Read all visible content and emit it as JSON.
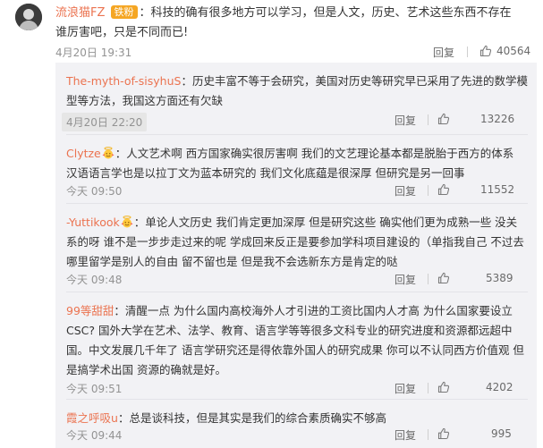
{
  "top_comment": {
    "username": "流浪猫FZ",
    "badge": "铁粉",
    "separator": "：",
    "text": "科技的确有很多地方可以学习，但是人文，历史、艺术这些东西不存在谁厉害吧，只是不同而已!",
    "time": "4月20日 19:31",
    "reply_label": "回复",
    "likes": "40564"
  },
  "replies": [
    {
      "username": "The-myth-of-sisyhuS",
      "separator": "：",
      "text": "历史丰富不等于会研究，美国对历史等研究早已采用了先进的数学模型等方法，我国这方面还有欠缺",
      "time": "4月20日 22:20",
      "reply_label": "回复",
      "likes": "13226"
    },
    {
      "username": "Clytze",
      "separator": "：",
      "text": "人文艺术啊 西方国家确实很厉害啊  我们的文艺理论基本都是脱胎于西方的体系 汉语语言学也是以拉丁文为蓝本研究的 我们文化底蕴是很深厚 但研究是另一回事",
      "time": "今天 09:50",
      "reply_label": "回复",
      "likes": "11552"
    },
    {
      "username": "-Yuttikook",
      "separator": "：",
      "text": "单论人文历史 我们肯定更加深厚 但是研究这些 确实他们更为成熟一些 没关系的呀 谁不是一步步走过来的呢 学成回来反正是要参加学科项目建设的（单指我自己   不过去哪里留学是别人的自由 留不留也是 但是我不会选新东方是肯定的哒",
      "time": "今天 09:48",
      "reply_label": "回复",
      "likes": "5389"
    },
    {
      "username": "99等甜甜",
      "separator": "：",
      "text": "清醒一点 为什么国内高校海外人才引进的工资比国内人才高 为什么国家要设立CSC? 国外大学在艺术、法学、教育、语言学等等很多文科专业的研究进度和资源都远超中国。中文发展几千年了 语言学研究还是得依靠外国人的研究成果 你可以不认同西方价值观 但是搞学术出国 资源的确就是好。",
      "time": "今天 09:51",
      "reply_label": "回复",
      "likes": "4202"
    },
    {
      "username": "霞之呼吸u",
      "separator": "：",
      "text": "总是谈科技，但是其实是我们的综合素质确实不够高",
      "time": "今天 09:44",
      "reply_label": "回复",
      "likes": "995"
    }
  ],
  "colors": {
    "username": "#eb7350",
    "badge": "#f5a623",
    "panel": "#f2f2f5",
    "meta": "#939393"
  },
  "icons": {
    "like": "thumbs-up-icon",
    "emoji": "angel-emoji-icon"
  }
}
